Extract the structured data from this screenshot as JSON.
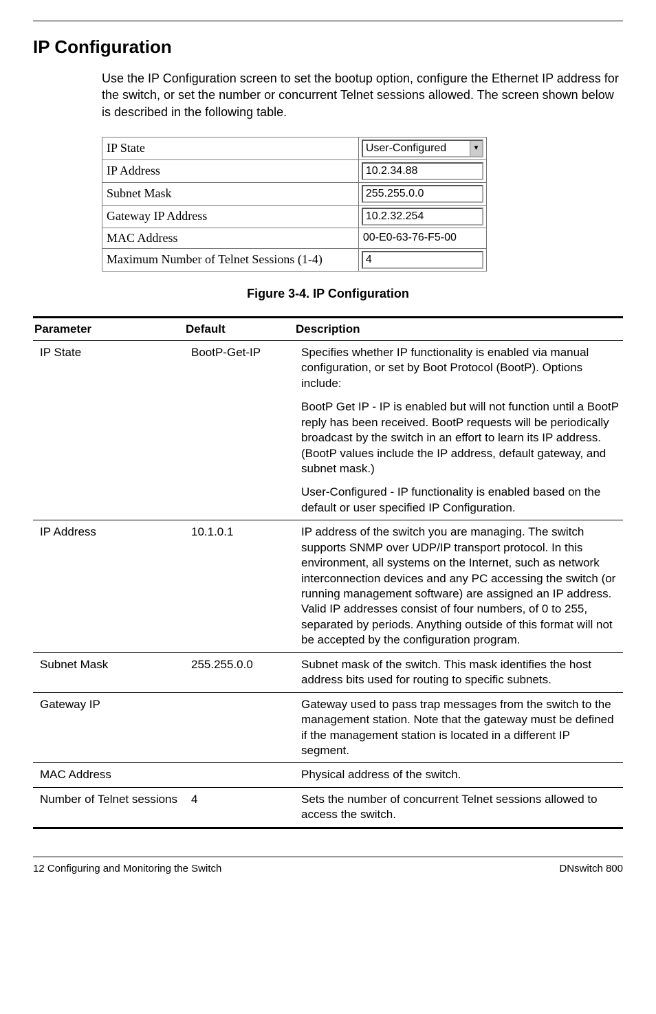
{
  "heading": "IP Configuration",
  "intro": "Use the IP Configuration screen to set the bootup option, configure the Ethernet IP address for the switch, or set the number or concurrent Telnet sessions allowed. The screen shown below is described in the following table.",
  "config_rows": [
    {
      "label": "IP State",
      "value": "User-Configured",
      "type": "select"
    },
    {
      "label": "IP Address",
      "value": "10.2.34.88",
      "type": "input"
    },
    {
      "label": "Subnet Mask",
      "value": "255.255.0.0",
      "type": "input"
    },
    {
      "label": "Gateway IP Address",
      "value": "10.2.32.254",
      "type": "input"
    },
    {
      "label": "MAC Address",
      "value": "00-E0-63-76-F5-00",
      "type": "static"
    }
  ],
  "config_last": {
    "label": "Maximum Number of Telnet Sessions (1-4)",
    "value": "4",
    "type": "input"
  },
  "figure_caption": "Figure 3-4.  IP Configuration",
  "table_headers": {
    "param": "Parameter",
    "default": "Default",
    "desc": "Description"
  },
  "rows": [
    {
      "param": "IP State",
      "default": "BootP-Get-IP",
      "descs": [
        "Specifies whether IP functionality is enabled via manual configuration, or set by Boot Protocol (BootP). Options include:",
        "BootP Get IP - IP is enabled but will not function until a BootP reply has been received. BootP requests will be periodically broadcast by the switch in an effort to learn its IP address. (BootP values include the IP address, default gateway, and subnet mask.)",
        "User-Configured - IP functionality is enabled based on the default or user specified IP Configuration."
      ]
    },
    {
      "param": "IP Address",
      "default": "10.1.0.1",
      "descs": [
        "IP address of the switch you are managing. The switch supports SNMP over UDP/IP transport protocol.  In this environment, all systems on the Internet, such as network interconnection devices and any PC accessing the switch (or running management software) are assigned an IP address. Valid IP addresses consist of four numbers, of 0 to 255, separated by periods. Anything outside of this format will not be accepted by the configuration program."
      ]
    },
    {
      "param": "Subnet Mask",
      "default": "255.255.0.0",
      "descs": [
        "Subnet mask of the switch. This mask identifies the host address bits used for routing to specific subnets."
      ]
    },
    {
      "param": "Gateway IP",
      "default": "",
      "descs": [
        "Gateway used to pass trap messages from the switch to the management station. Note that the gateway must be defined if the management station is located in a different IP segment."
      ]
    },
    {
      "param": "MAC Address",
      "default": "",
      "descs": [
        "Physical address of the switch."
      ]
    },
    {
      "param": "Number of Telnet sessions",
      "default": "4",
      "descs": [
        "Sets the number of concurrent Telnet sessions allowed to access the switch."
      ]
    }
  ],
  "footer": {
    "left": "12  Configuring and Monitoring the Switch",
    "right": "DNswitch 800"
  }
}
